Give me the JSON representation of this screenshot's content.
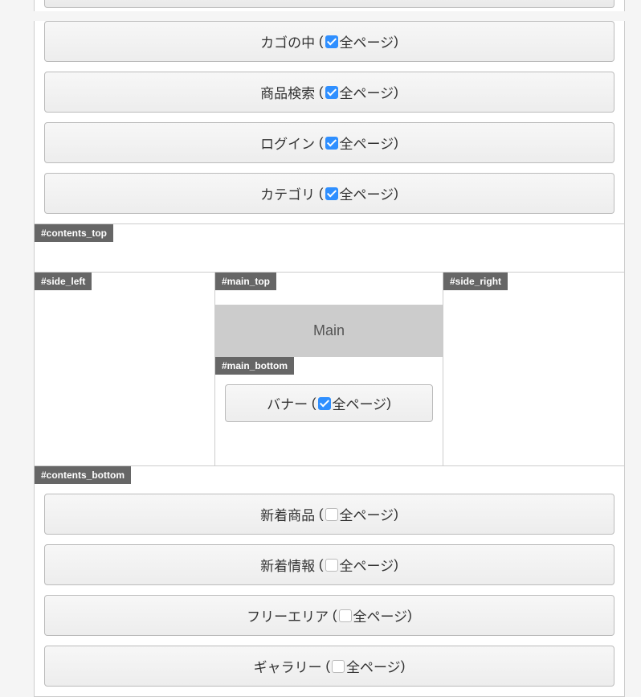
{
  "labels": {
    "contents_top": "#contents_top",
    "side_left": "#side_left",
    "main_top": "#main_top",
    "side_right": "#side_right",
    "main_center": "Main",
    "main_bottom": "#main_bottom",
    "contents_bottom": "#contents_bottom"
  },
  "all_pages_text": "全ページ",
  "top_blocks": [
    {
      "name": "カゴの中",
      "checked": true
    },
    {
      "name": "商品検索",
      "checked": true
    },
    {
      "name": "ログイン",
      "checked": true
    },
    {
      "name": "カテゴリ",
      "checked": true
    }
  ],
  "main_bottom_blocks": [
    {
      "name": "バナー",
      "checked": true
    }
  ],
  "bottom_blocks": [
    {
      "name": "新着商品",
      "checked": false
    },
    {
      "name": "新着情報",
      "checked": false
    },
    {
      "name": "フリーエリア",
      "checked": false
    },
    {
      "name": "ギャラリー",
      "checked": false
    }
  ]
}
